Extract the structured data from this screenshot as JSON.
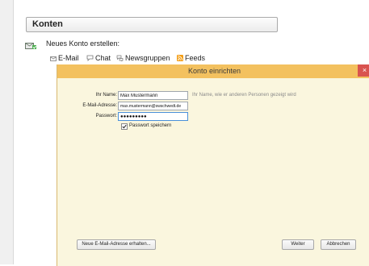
{
  "konten": {
    "title": "Konten",
    "new_account_label": "Neues Konto erstellen:",
    "account_types": [
      {
        "label": "E-Mail",
        "icon": "envelope-icon"
      },
      {
        "label": "Chat",
        "icon": "chat-icon"
      },
      {
        "label": "Newsgruppen",
        "icon": "newsgroups-icon"
      },
      {
        "label": "Feeds",
        "icon": "rss-icon"
      }
    ]
  },
  "dialog": {
    "title": "Konto einrichten",
    "close": "×",
    "name_label": "Ihr Name:",
    "name_value": "Max Mustermann",
    "name_hint": "Ihr Name, wie er anderen Personen gezeigt wird",
    "email_label": "E-Mail-Adresse:",
    "email_value": "max.mustermann@swschwedt.de",
    "password_label": "Passwort:",
    "password_value": "●●●●●●●●●",
    "remember_label": "Passwort speichern",
    "remember_checked": true,
    "get_new_email_button": "Neue E-Mail-Adresse erhalten...",
    "next_button": "Weiter",
    "cancel_button": "Abbrechen"
  },
  "colors": {
    "dialog_title_bar": "#f3c15f",
    "dialog_background": "#faf6de",
    "close_button": "#d9534f"
  }
}
